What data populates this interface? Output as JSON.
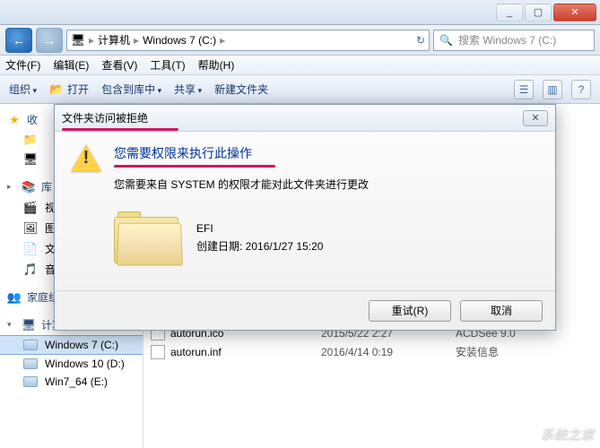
{
  "window": {
    "min": "_",
    "max": "▢",
    "close": "✕"
  },
  "nav": {
    "back": "←",
    "fwd": "→",
    "path_root_icon": "🖥",
    "path_computer": "计算机",
    "path_drive": "Windows 7 (C:)",
    "refresh": "↻",
    "search_placeholder": "搜索 Windows 7 (C:)",
    "search_icon": "🔍"
  },
  "menu": {
    "file": "文件(F)",
    "edit": "编辑(E)",
    "view": "查看(V)",
    "tools": "工具(T)",
    "help": "帮助(H)"
  },
  "toolbar": {
    "organize": "组织",
    "open": "打开",
    "include": "包含到库中",
    "share": "共享",
    "newfolder": "新建文件夹",
    "view_icon": "☰",
    "help_icon": "?"
  },
  "sidebar": {
    "favorites": "收",
    "fav_item": "",
    "libraries": "库",
    "lib_video": "视",
    "lib_pic": "图",
    "lib_doc": "文",
    "lib_music": "音",
    "homegroup": "家庭组",
    "computer": "计算机",
    "drive_c": "Windows 7 (C:)",
    "drive_d": "Windows 10 (D:)",
    "drive_e": "Win7_64 (E:)"
  },
  "files": {
    "row1": {
      "name": "autorun.ico",
      "date": "2015/5/22 2:27",
      "type": "ACDSee 9.0"
    },
    "row2": {
      "name": "autorun.inf",
      "date": "2016/4/14 0:19",
      "type": "安装信息"
    }
  },
  "dialog": {
    "title": "文件夹访问被拒绝",
    "heading": "您需要权限来执行此操作",
    "body": "您需要来自 SYSTEM 的权限才能对此文件夹进行更改",
    "folder_name": "EFI",
    "folder_date_label": "创建日期: ",
    "folder_date": "2016/1/27 15:20",
    "retry": "重试(R)",
    "cancel": "取消",
    "close": "✕"
  },
  "watermark": "系统之家"
}
